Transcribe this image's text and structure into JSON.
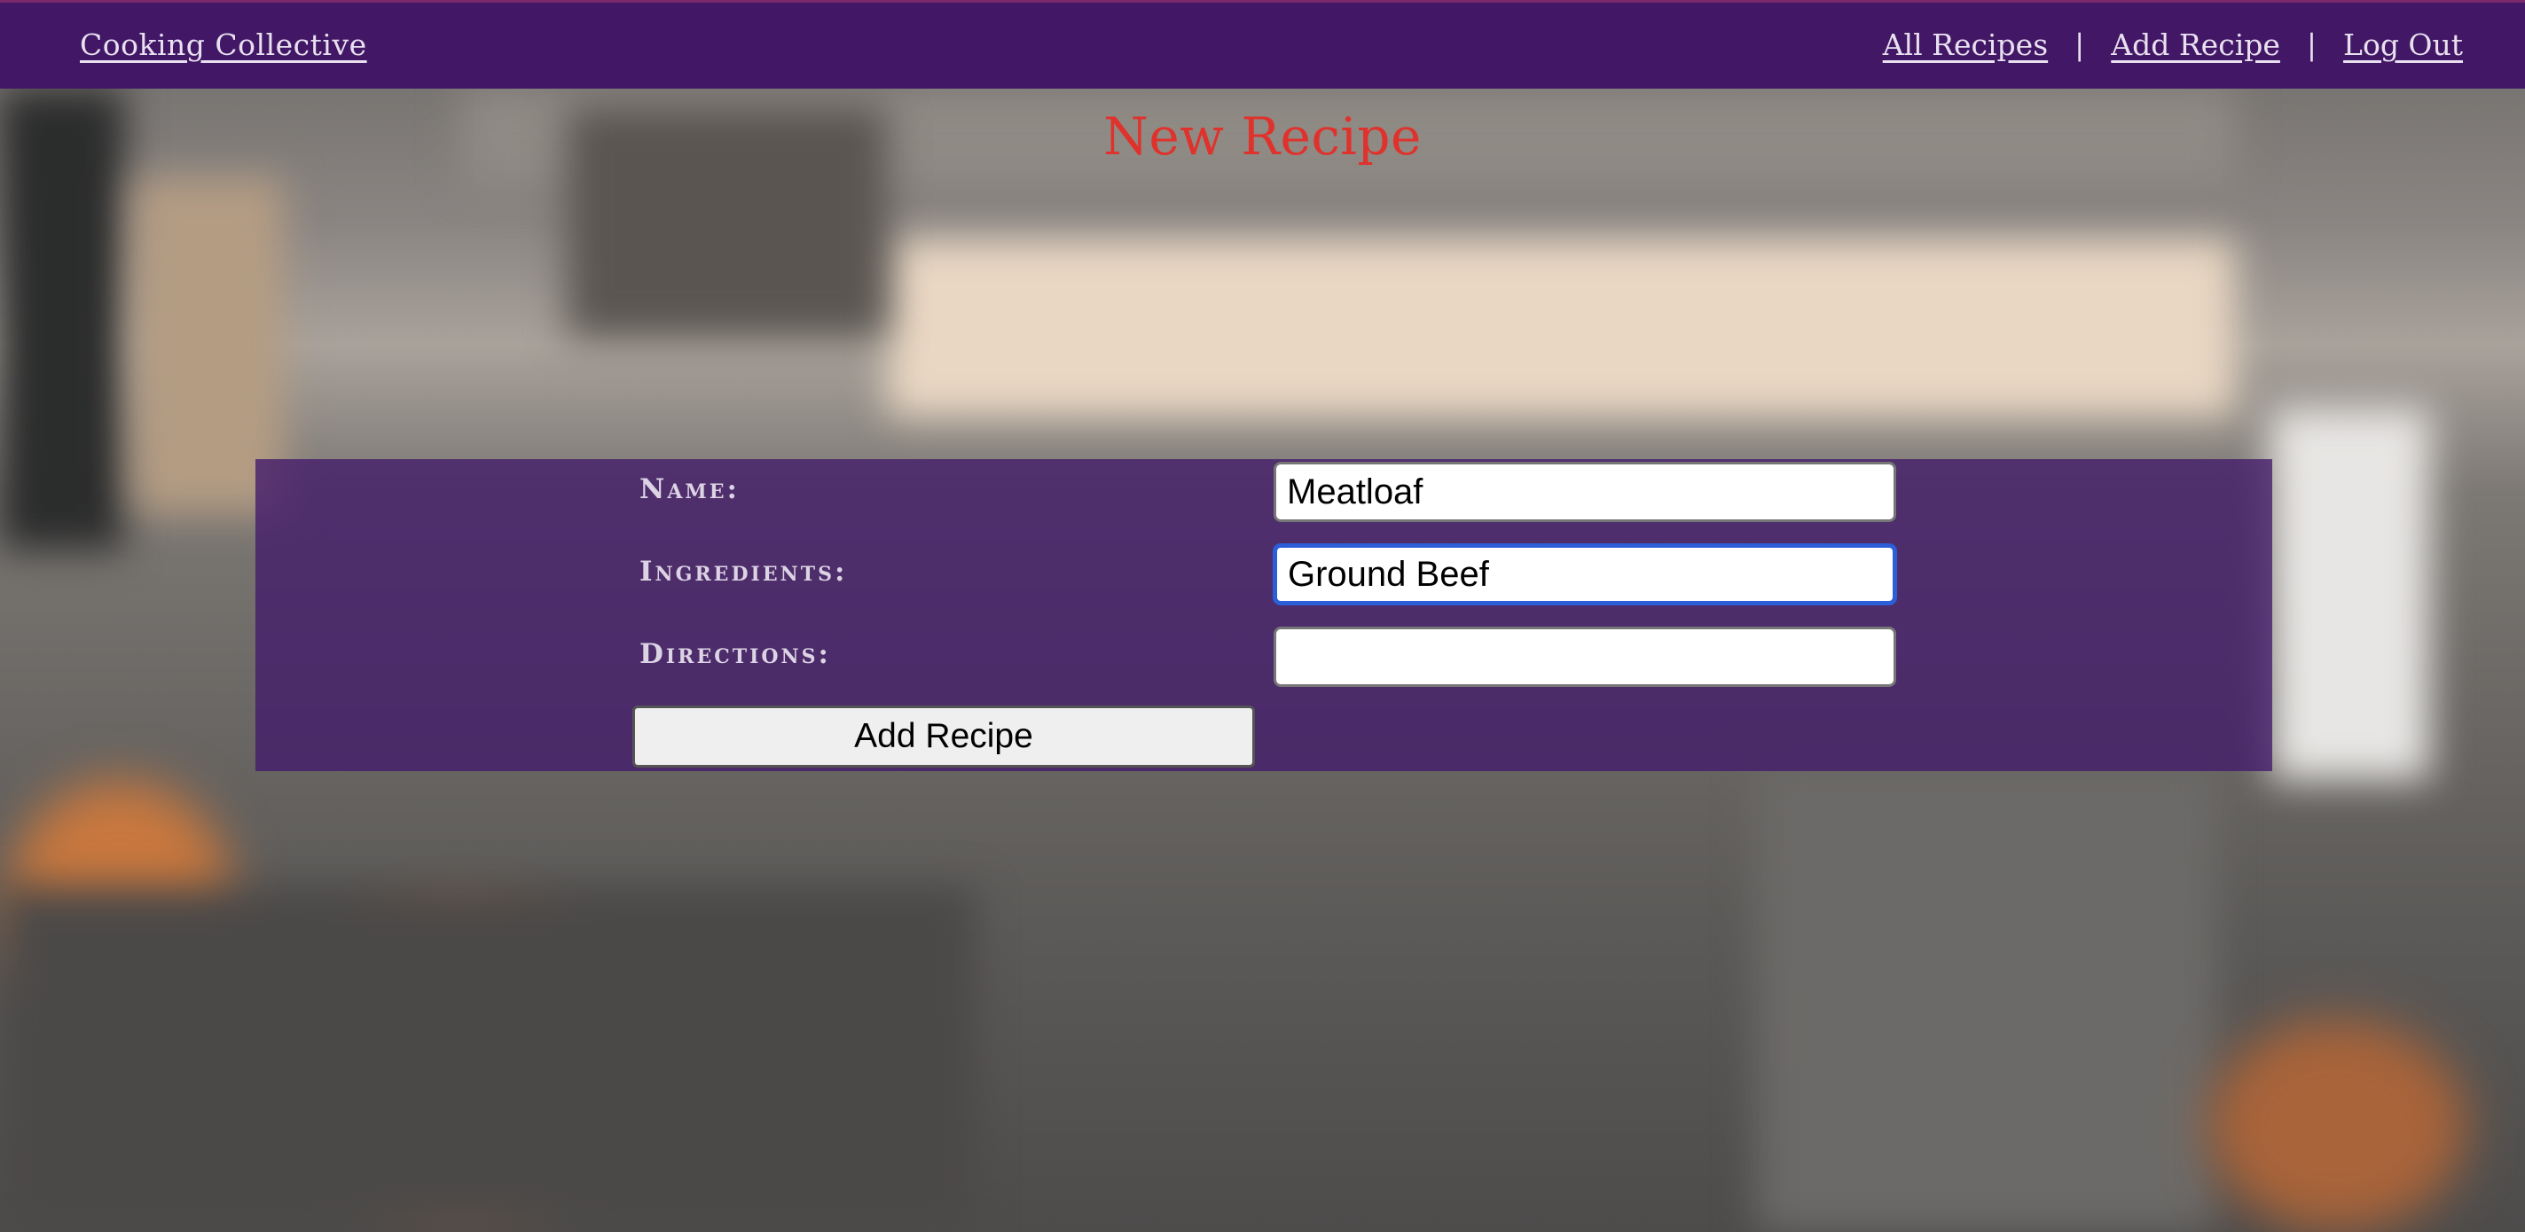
{
  "nav": {
    "brand": "Cooking Collective",
    "links": [
      "All Recipes",
      "Add Recipe",
      "Log Out"
    ],
    "separator": "|"
  },
  "page": {
    "title": "New Recipe"
  },
  "form": {
    "fields": [
      {
        "label": "Name:",
        "value": "Meatloaf",
        "placeholder": ""
      },
      {
        "label": "Ingredients:",
        "value": "Ground Beef",
        "placeholder": ""
      },
      {
        "label": "Directions:",
        "value": "",
        "placeholder": ""
      }
    ],
    "submit_label": "Add Recipe"
  },
  "colors": {
    "navbar": "#421866",
    "title": "#e0322c",
    "panel": "#421a6a",
    "focus_ring": "#2a5fd8"
  }
}
